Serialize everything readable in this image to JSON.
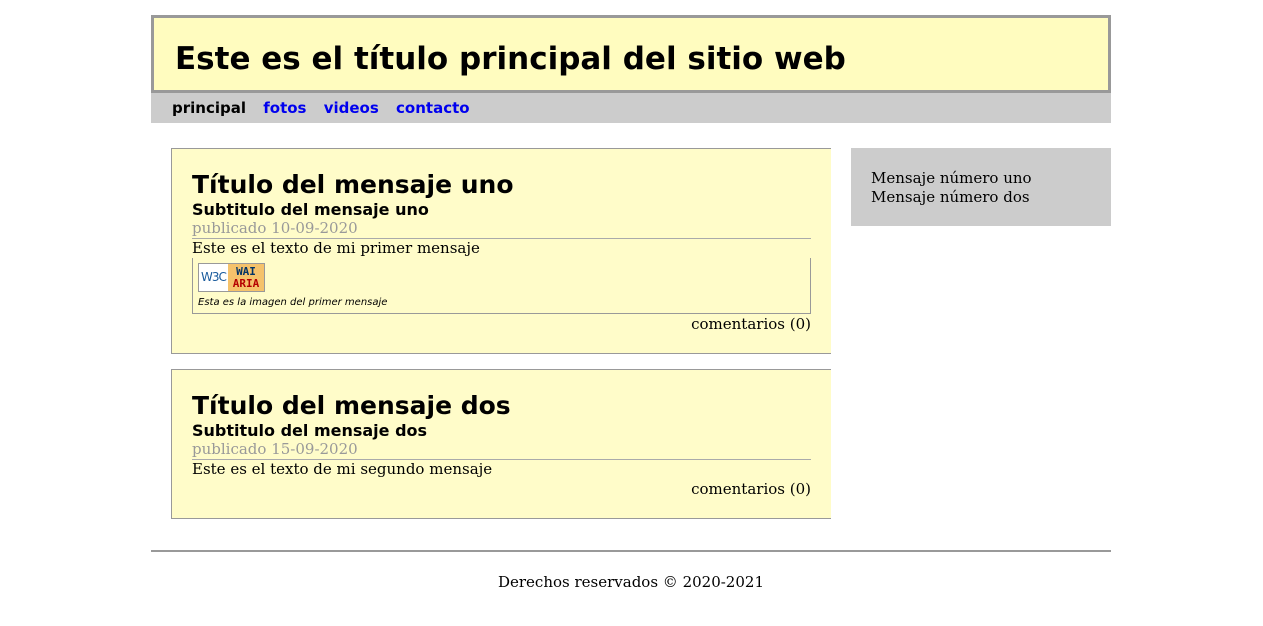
{
  "site": {
    "title": "Este es el título principal del sitio web"
  },
  "nav": {
    "items": [
      {
        "label": "principal",
        "current": true
      },
      {
        "label": "fotos",
        "current": false
      },
      {
        "label": "videos",
        "current": false
      },
      {
        "label": "contacto",
        "current": false
      }
    ]
  },
  "posts": [
    {
      "title": "Título del mensaje uno",
      "subtitle": "Subtitulo del mensaje uno",
      "date": "publicado 10-09-2020",
      "text": "Este es el texto de mi primer mensaje",
      "image": {
        "badge_left": "W3C",
        "badge_top": "WAI",
        "badge_bottom": "ARIA",
        "caption": "Esta es la imagen del primer mensaje"
      },
      "comments": "comentarios (0)"
    },
    {
      "title": "Título del mensaje dos",
      "subtitle": "Subtitulo del mensaje dos",
      "date": "publicado 15-09-2020",
      "text": "Este es el texto de mi segundo mensaje",
      "comments": "comentarios (0)"
    }
  ],
  "aside": {
    "items": [
      "Mensaje número uno",
      "Mensaje número dos"
    ]
  },
  "footer": {
    "text": "Derechos reservados © 2020-2021"
  },
  "colors": {
    "header_bg": "#fffcbf",
    "post_bg": "#fffcc9",
    "nav_bg": "#cccccc",
    "link": "#0000ee",
    "border": "#999999"
  }
}
